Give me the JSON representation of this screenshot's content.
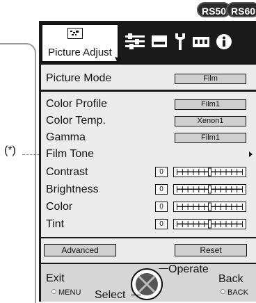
{
  "badges": [
    "RS50",
    "RS60"
  ],
  "annotation": "(*)",
  "tabs": {
    "active_label": "Picture Adjust",
    "icons": [
      "picture-icon",
      "sliders-icon",
      "screen-icon",
      "wrench-icon",
      "ports-icon",
      "info-icon"
    ]
  },
  "mode": {
    "label": "Picture Mode",
    "value": "Film"
  },
  "settings": [
    {
      "label": "Color Profile",
      "value": "Film1"
    },
    {
      "label": "Color Temp.",
      "value": "Xenon1"
    },
    {
      "label": "Gamma",
      "value": "Film1"
    },
    {
      "label": "Film Tone",
      "submenu": true
    }
  ],
  "sliders": [
    {
      "label": "Contrast",
      "value": "0",
      "level": 0.5
    },
    {
      "label": "Brightness",
      "value": "0",
      "level": 0.5
    },
    {
      "label": "Color",
      "value": "0",
      "level": 0.5
    },
    {
      "label": "Tint",
      "value": "0",
      "level": 0.5
    }
  ],
  "buttons": {
    "advanced": "Advanced",
    "reset": "Reset"
  },
  "footer": {
    "exit": "Exit",
    "exit_key": "MENU",
    "select": "Select",
    "operate": "Operate",
    "back": "Back",
    "back_key": "BACK"
  }
}
